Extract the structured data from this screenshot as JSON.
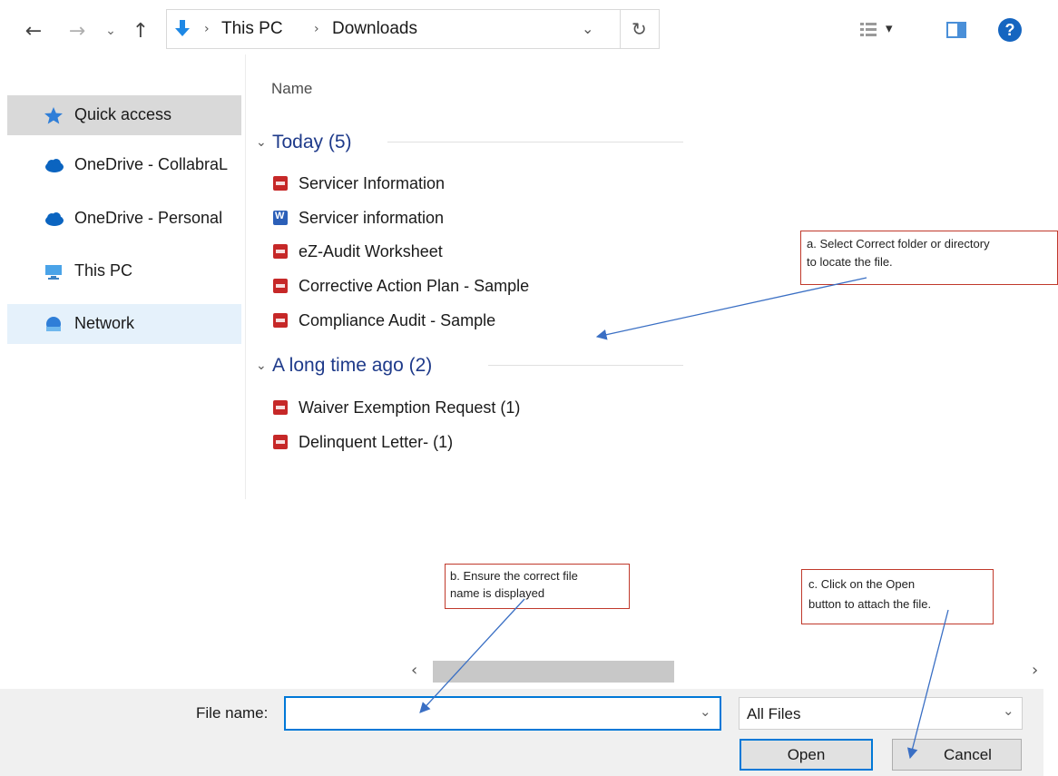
{
  "toolbar": {
    "back": "←",
    "forward": "→",
    "recent": "⌄",
    "up": "↑",
    "breadcrumb": [
      "This PC",
      "Downloads"
    ],
    "breadcrumb_sep": "›",
    "dropdown": "⌄",
    "refresh": "↻",
    "view_dropdown": "▾",
    "help": "?"
  },
  "nav": {
    "items": [
      {
        "label": "Quick access",
        "icon": "star-icon"
      },
      {
        "label": "OneDrive - CollabraL",
        "icon": "cloud-icon"
      },
      {
        "label": "OneDrive - Personal",
        "icon": "cloud-icon"
      },
      {
        "label": "This PC",
        "icon": "computer-icon"
      },
      {
        "label": "Network",
        "icon": "network-icon"
      }
    ]
  },
  "list": {
    "column_name": "Name",
    "groups": [
      {
        "title": "Today (5)",
        "files": [
          {
            "name": "Servicer Information",
            "type": "pdf"
          },
          {
            "name": "Servicer information",
            "type": "word"
          },
          {
            "name": "eZ-Audit Worksheet",
            "type": "pdf"
          },
          {
            "name": "Corrective Action Plan - Sample",
            "type": "pdf"
          },
          {
            "name": "Compliance Audit - Sample",
            "type": "pdf"
          }
        ]
      },
      {
        "title": "A long time ago (2)",
        "files": [
          {
            "name": "Waiver Exemption Request (1)",
            "type": "pdf"
          },
          {
            "name": "Delinquent Letter- (1)",
            "type": "pdf"
          }
        ]
      }
    ]
  },
  "annotations": {
    "a_line1": "a. Select Correct folder or directory",
    "a_line2": "to locate the file.",
    "b_line1": "b. Ensure the correct file",
    "b_line2": "name is displayed",
    "c_line1": "c. Click on the Open",
    "c_line2": "button to attach the file."
  },
  "scrollbar": {
    "left": "‹",
    "right": "›"
  },
  "bottom": {
    "file_name_label": "File name:",
    "file_name_value": "",
    "file_type": "All Files",
    "open_label": "Open",
    "cancel_label": "Cancel"
  },
  "colors": {
    "accent": "#0078d7",
    "annotation_border": "#c0392b",
    "arrow": "#3a6fc4"
  }
}
